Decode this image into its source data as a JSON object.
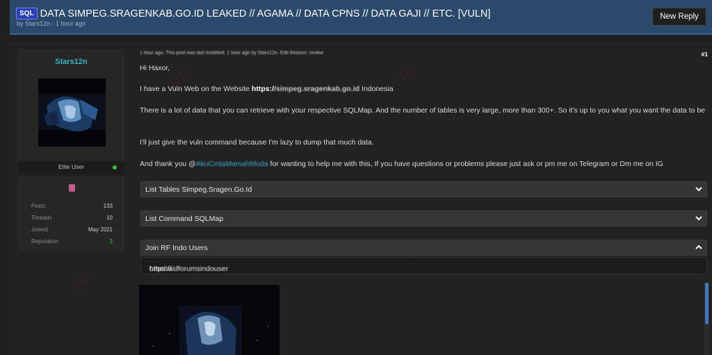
{
  "header": {
    "tag": "SQL",
    "title": "DATA SIMPEG.SRAGENKAB.GO.ID LEAKED // AGAMA // DATA CPNS // DATA GAJI // ETC. [VULN]",
    "subtitle": "by Stars12n - 1 hour ago",
    "new_reply_label": "New Reply"
  },
  "user": {
    "name": "Stars12n",
    "title": "Elite User",
    "stats": [
      {
        "label": "Posts",
        "value": "133"
      },
      {
        "label": "Threads",
        "value": "10"
      },
      {
        "label": "Joined",
        "value": "May 2021"
      },
      {
        "label": "Reputation",
        "value": "3"
      }
    ],
    "online_color": "#3ec33e"
  },
  "post": {
    "meta": "1 hour ago. This post was last modified: 1 hour ago by Stars12n. Edit Reason: review",
    "number": "#1",
    "greeting": "Hi Haxor,",
    "line1_prefix": "I have a Vuln Web on the Website ",
    "line1_link_prefix": "https:/",
    "line1_link_blur": "/simpeg.sragenkab.go.id",
    "line1_suffix": " Indonesia",
    "line2": "There is a lot of data that you can retrieve with your respective SQLMap. And the number of tables is very large, more than 300+. So it's up to you what you want the data to be",
    "line3": "I'll just give the vuln command because I'm lazy to dump that much data.",
    "line4_prefix": "And thank you @",
    "line4_mention": "AkuCintaMamahMuda",
    "line4_suffix": " for wanting to help me with this, If you have questions or problems please just ask or pm me on Telegram or Dm me on IG",
    "spoilers": [
      {
        "label": "List Tables Simpeg.Sragen.Go.Id",
        "state": "collapsed"
      },
      {
        "label": "List Command SQLMap",
        "state": "collapsed"
      },
      {
        "label": "Join RF Indo Users",
        "state": "expanded"
      }
    ],
    "spoiler_content_prefix": "https://",
    "spoiler_content_blur": "t.me/raidforumsindouser"
  },
  "colors": {
    "header_bg": "#2b4a6b",
    "accent": "#3f77b6",
    "username": "#37b8c9",
    "mention": "#35a8c7"
  }
}
